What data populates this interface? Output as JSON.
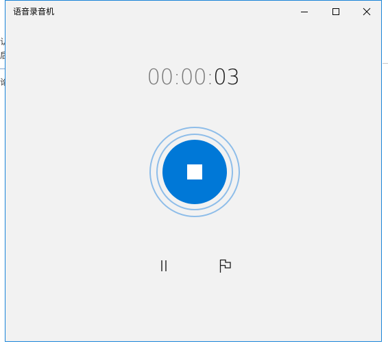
{
  "window": {
    "title": "语音录音机",
    "accent_color": "#0078d7",
    "border_color": "#1883d7",
    "background_color": "#f2f2f2"
  },
  "timer": {
    "dim_part": "00:00:",
    "bright_part": "03"
  },
  "controls": {
    "record_icon": "stop-icon",
    "pause_icon": "pause-icon",
    "flag_icon": "flag-icon"
  },
  "background": {
    "char_1": "认",
    "char_2": "后",
    "char_3": "论"
  }
}
